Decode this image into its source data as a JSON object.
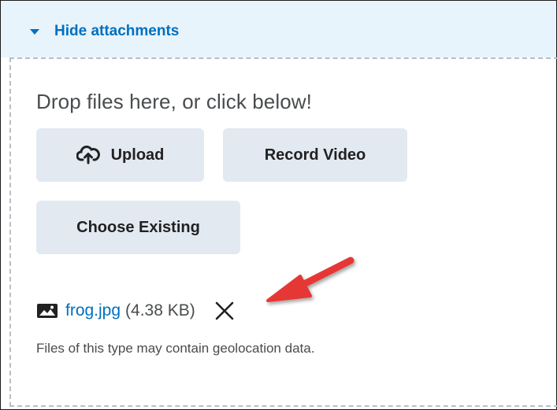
{
  "header": {
    "toggle_label": "Hide attachments",
    "toggle_icon": "caret-down-icon"
  },
  "dropzone": {
    "hint": "Drop files here, or click below!"
  },
  "buttons": {
    "upload": "Upload",
    "record_video": "Record Video",
    "choose_existing": "Choose Existing"
  },
  "attachment": {
    "file_name": "frog.jpg",
    "file_size": "(4.38 KB)",
    "file_icon": "image-icon",
    "remove_icon": "close-icon"
  },
  "notice": {
    "geolocation": "Files of this type may contain geolocation data."
  },
  "colors": {
    "accent": "#006fbf",
    "header_bg": "#e7f4fb",
    "button_bg": "#e3e9f1",
    "annotation_arrow": "#e53935"
  }
}
